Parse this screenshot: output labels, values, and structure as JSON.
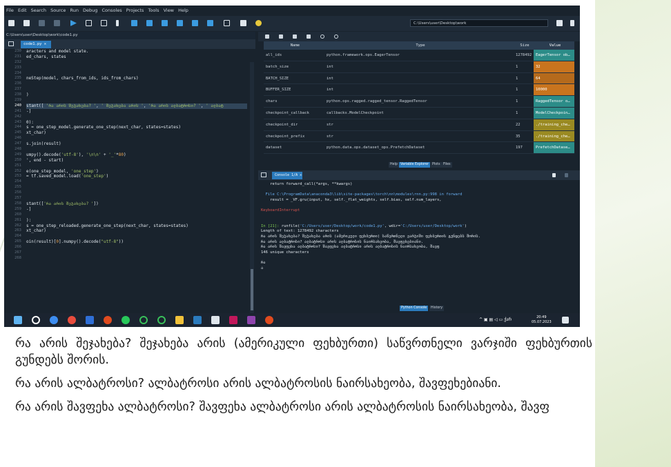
{
  "menubar": [
    "File",
    "Edit",
    "Search",
    "Source",
    "Run",
    "Debug",
    "Consoles",
    "Projects",
    "Tools",
    "View",
    "Help"
  ],
  "toolbar": {
    "path": "C:\\Users\\user\\Desktop\\work"
  },
  "editor": {
    "file_path": "C:\\Users\\user\\Desktop\\work\\code1.py",
    "tab_label": "code1.py ✕",
    "line_numbers": [
      "230",
      "231",
      "232",
      "233",
      "234",
      "235",
      "236",
      "237",
      "238",
      "239",
      "240",
      "241",
      "242",
      "243",
      "244",
      "245",
      "246",
      "247",
      "248",
      "249",
      "250",
      "251",
      "252",
      "253",
      "254",
      "255",
      "256",
      "257",
      "258",
      "259",
      "260",
      "261",
      "262",
      "263",
      "264",
      "265",
      "266",
      "267",
      "268"
    ],
    "current_line": "240"
  },
  "variable_explorer": {
    "headers": [
      "Name",
      "Type",
      "Size",
      "Value"
    ],
    "rows": [
      {
        "name": "all_ids",
        "type": "python.framework.ops.EagerTensor",
        "size": "1278492",
        "value": "EagerTensor ob…",
        "color": "#2c8c88"
      },
      {
        "name": "batch_size",
        "type": "int",
        "size": "1",
        "value": "32",
        "color": "#c8741e"
      },
      {
        "name": "BATCH_SIZE",
        "type": "int",
        "size": "1",
        "value": "64",
        "color": "#b56a1c"
      },
      {
        "name": "BUFFER_SIZE",
        "type": "int",
        "size": "1",
        "value": "10000",
        "color": "#c8741e"
      },
      {
        "name": "chars",
        "type": "python.ops.ragged.ragged_tensor.RaggedTensor",
        "size": "1",
        "value": "RaggedTensor o…",
        "color": "#2c8c88"
      },
      {
        "name": "checkpoint_callback",
        "type": "callbacks.ModelCheckpoint",
        "size": "1",
        "value": "ModelCheckpoin…",
        "color": "#2c8c88"
      },
      {
        "name": "checkpoint_dir",
        "type": "str",
        "size": "22",
        "value": "./training_che…",
        "color": "#9a8a22"
      },
      {
        "name": "checkpoint_prefix",
        "type": "str",
        "size": "35",
        "value": "./training_che…",
        "color": "#9a8a22"
      },
      {
        "name": "dataset",
        "type": "python.data.ops.dataset_ops.PrefetchDataset",
        "size": "197",
        "value": "PrefetchDatase…",
        "color": "#2c8c88"
      }
    ],
    "tabs": [
      "Help",
      "Variable Explorer",
      "Plots",
      "Files"
    ]
  },
  "console": {
    "tab_label": "Console 1/A ✕",
    "tabs": [
      "Python Console",
      "History"
    ]
  },
  "statusbar": "conda: base (Python 3.10.9)   ✓ Completions: conda   ✓ LSP: Python   Line 240, Col 45   UTF-8-GUESSED   CRLF   RW   Mem 49%",
  "taskbar": {
    "time": "20:49",
    "date": "05.07.2023",
    "lang": "ქარ"
  },
  "slide_paragraphs": [
    "რა არის შეჯახება? შეჯახება არის (ამერიკული ფეხბურთი) საწვრთნელი ვარჯიში ფეხბურთის გუნდებს შორის.",
    "რა არის ალბატროსი? ალბატროსი არის ალბატროსის ნაირსახეობა, შავფეხებიანი.",
    "რა არის შავფეხა ალბატროსი? შავფეხა ალბატროსი არის ალბატროსის ნაირსახეობა, შავფ"
  ]
}
